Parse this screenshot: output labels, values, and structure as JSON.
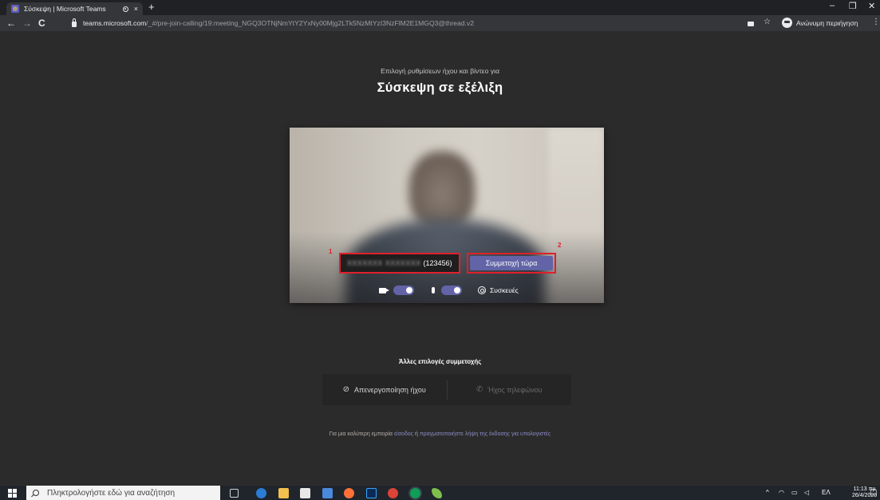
{
  "browser": {
    "tab_title": "Σύσκεψη | Microsoft Teams",
    "new_tab": "+",
    "tab_close": "×",
    "url_host": "teams.microsoft.com",
    "url_path": "/_#/pre-join-calling/19:meeting_NGQ3OTNjNmYtY2YxNy00Mjg2LTk5NzMtYzI3NzFlM2E1MGQ3@thread.v2",
    "profile_label": "Ανώνυμη περιήγηση",
    "back": "←",
    "forward": "→",
    "reload": "C",
    "star": "☆",
    "menu": "⋮",
    "minimize": "–",
    "maximize": "❐",
    "close": "✕"
  },
  "prejoin": {
    "subtitle": "Επιλογή ρυθμίσεων ήχου και βίντεο για",
    "meeting_title": "Σύσκεψη σε εξέλιξη",
    "name_blurred": "ΧΧΧΧΧΧΧ ΧΧΧΧΧΧΧ",
    "name_suffix": "(123456)",
    "join_label": "Συμμετοχή τώρα",
    "marker_1": "1",
    "marker_2": "2",
    "devices_label": "Συσκευές",
    "video_on": true,
    "mic_on": true,
    "accent": "#6264a7",
    "marker_color": "#e0202a"
  },
  "other_options": {
    "heading": "Άλλες επιλογές συμμετοχής",
    "mute_label": "Απενεργοποίηση ήχου",
    "phone_label": "Ήχος τηλεφώνου"
  },
  "footer": {
    "prefix": "Για μια καλύτερη εμπειρία",
    "link1": "είσοδος",
    "middle": "ή",
    "link2": "πραγματοποιήστε λήψη της έκδοσης για υπολογιστές"
  },
  "taskbar": {
    "search_placeholder": "Πληκτρολογήστε εδώ για αναζήτηση",
    "language": "ΕΛ",
    "time": "11:13 πμ",
    "date": "26/4/2020",
    "tray_chevron": "^"
  }
}
